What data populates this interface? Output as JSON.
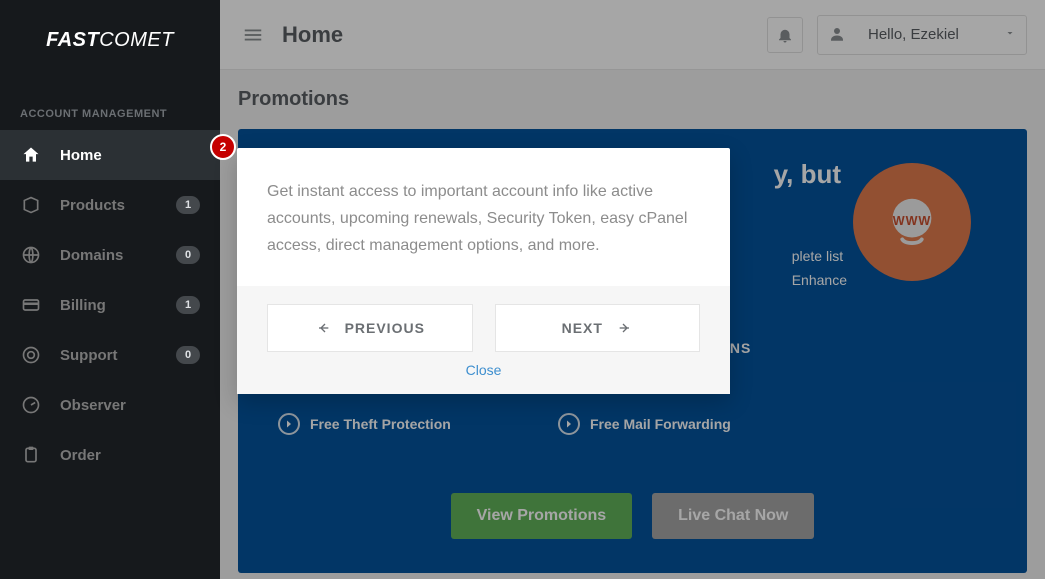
{
  "brand": {
    "part1": "FAST",
    "part2": "COMET"
  },
  "sidebar": {
    "section_label": "ACCOUNT MANAGEMENT",
    "items": [
      {
        "label": "Home",
        "count": null,
        "active": true
      },
      {
        "label": "Products",
        "count": "1",
        "active": false
      },
      {
        "label": "Domains",
        "count": "0",
        "active": false
      },
      {
        "label": "Billing",
        "count": "1",
        "active": false
      },
      {
        "label": "Support",
        "count": "0",
        "active": false
      },
      {
        "label": "Observer",
        "count": null,
        "active": false
      },
      {
        "label": "Order",
        "count": null,
        "active": false
      }
    ]
  },
  "header": {
    "title": "Home",
    "greeting": "Hello, Ezekiel"
  },
  "page": {
    "section_title": "Promotions"
  },
  "promo": {
    "headline_tail": "y, but",
    "desc_tail_1": "plete list",
    "desc_tail_2": "Enhance",
    "feature_row_top": "ONS",
    "features": [
      "Free Theft Protection",
      "Free Mail Forwarding"
    ],
    "cta1": "View Promotions",
    "cta2": "Live Chat Now"
  },
  "tour": {
    "badge": "2",
    "body": "Get instant access to important account info like active accounts, upcoming renewals, Security Token, easy cPanel access, direct management options, and more.",
    "prev": "PREVIOUS",
    "next": "NEXT",
    "close": "Close"
  }
}
